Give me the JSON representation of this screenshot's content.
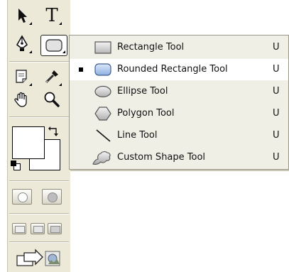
{
  "toolbox": {
    "type_tool_glyph": "T"
  },
  "shape_menu": {
    "selected_index": 1,
    "items": [
      {
        "label": "Rectangle Tool",
        "shortcut": "U",
        "icon": "rectangle-icon"
      },
      {
        "label": "Rounded Rectangle Tool",
        "shortcut": "U",
        "icon": "rounded-rectangle-icon"
      },
      {
        "label": "Ellipse Tool",
        "shortcut": "U",
        "icon": "ellipse-icon"
      },
      {
        "label": "Polygon Tool",
        "shortcut": "U",
        "icon": "polygon-icon"
      },
      {
        "label": "Line Tool",
        "shortcut": "U",
        "icon": "line-icon"
      },
      {
        "label": "Custom Shape Tool",
        "shortcut": "U",
        "icon": "custom-shape-icon"
      }
    ]
  },
  "colors": {
    "toolbox_bg": "#ece9d8",
    "menu_bg": "#f0efe6",
    "menu_selected_bg": "#ffffff",
    "foreground_color": "#ffffff",
    "background_color": "#ffffff",
    "selected_icon_fill": "#a9c4ea"
  }
}
